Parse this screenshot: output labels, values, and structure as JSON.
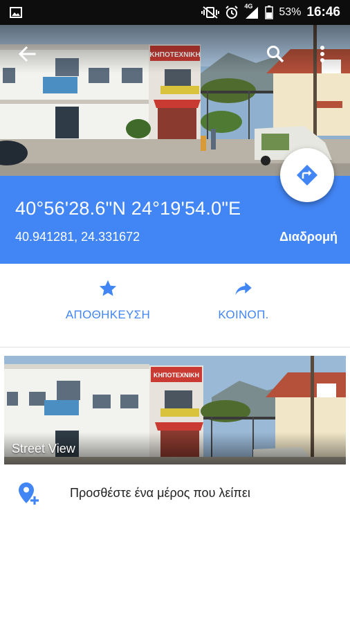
{
  "status_bar": {
    "battery": "53%",
    "time": "16:46",
    "network": "4G",
    "icons": [
      "gallery-icon",
      "mute-vibrate-icon",
      "alarm-icon",
      "signal-icon",
      "battery-icon"
    ]
  },
  "toolbar": {
    "back_icon": "arrow-back-icon",
    "search_icon": "search-icon",
    "more_icon": "more-vert-icon"
  },
  "sign_text": "ΚΗΠΟΤΕΧΝΙΚΗ",
  "location": {
    "dms": "40°56'28.6\"N 24°19'54.0\"E",
    "decimal": "40.941281, 24.331672",
    "route_label": "Διαδρομή"
  },
  "actions": {
    "save_label": "ΑΠΟΘΗΚΕΥΣΗ",
    "share_label": "ΚΟΙΝΟΠ."
  },
  "street_view": {
    "label": "Street View"
  },
  "add_place": {
    "label": "Προσθέστε ένα μέρος που λείπει"
  },
  "colors": {
    "accent": "#4285f4",
    "status_bar": "#0d0d0d"
  }
}
